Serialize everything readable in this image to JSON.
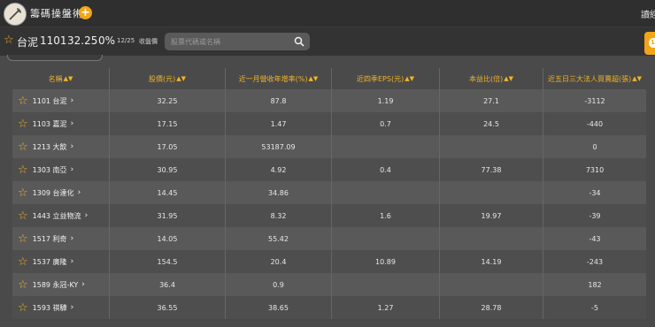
{
  "app": {
    "title": "籌碼操盤術",
    "add_label": "+",
    "top_right": "讀經"
  },
  "stock": {
    "name": "台泥",
    "code": "1101",
    "price": "32.25",
    "change": "0%",
    "date": "12/25",
    "status": "收盤價"
  },
  "search": {
    "placeholder": "股票代碼或名稱"
  },
  "side_button": {
    "label": "1"
  },
  "table": {
    "headers": [
      "名稱",
      "股價(元)",
      "近一月營收年增率(%)",
      "近四季EPS(元)",
      "本益比(倍)",
      "近五日三大法人買賣超(張)"
    ],
    "rows": [
      {
        "name": "1101 台泥",
        "price": "32.25",
        "rev": "87.8",
        "eps": "1.19",
        "pe": "27.1",
        "inst": "-3112"
      },
      {
        "name": "1103 嘉泥",
        "price": "17.15",
        "rev": "1.47",
        "eps": "0.7",
        "pe": "24.5",
        "inst": "-440"
      },
      {
        "name": "1213 大飲",
        "price": "17.05",
        "rev": "53187.09",
        "eps": "",
        "pe": "",
        "inst": "0"
      },
      {
        "name": "1303 南亞",
        "price": "30.95",
        "rev": "4.92",
        "eps": "0.4",
        "pe": "77.38",
        "inst": "7310"
      },
      {
        "name": "1309 台達化",
        "price": "14.45",
        "rev": "34.86",
        "eps": "",
        "pe": "",
        "inst": "-34"
      },
      {
        "name": "1443 立益物流",
        "price": "31.95",
        "rev": "8.32",
        "eps": "1.6",
        "pe": "19.97",
        "inst": "-39"
      },
      {
        "name": "1517 利奇",
        "price": "14.05",
        "rev": "55.42",
        "eps": "",
        "pe": "",
        "inst": "-43"
      },
      {
        "name": "1537 廣隆",
        "price": "154.5",
        "rev": "20.4",
        "eps": "10.89",
        "pe": "14.19",
        "inst": "-243"
      },
      {
        "name": "1589 永冠-KY",
        "price": "36.4",
        "rev": "0.9",
        "eps": "",
        "pe": "",
        "inst": "182"
      },
      {
        "name": "1593 祺驊",
        "price": "36.55",
        "rev": "38.65",
        "eps": "1.27",
        "pe": "28.78",
        "inst": "-5"
      }
    ]
  },
  "colors": {
    "accent": "#f2a516",
    "star": "#f0b428",
    "header_text": "#f0b428"
  }
}
